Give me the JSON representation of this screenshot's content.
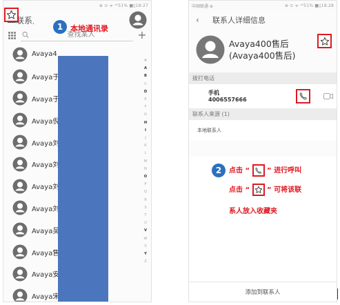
{
  "left_screen": {
    "statusbar_right": "⊕ ⊙ ᯤ ᵃˡˡ51% ■▯18:27",
    "header_title": "联系人",
    "search_placeholder": "查找某人",
    "contacts": [
      {
        "name": "Avaya4"
      },
      {
        "name": "Avaya于"
      },
      {
        "name": "Avaya于"
      },
      {
        "name": "Avaya倪"
      },
      {
        "name": "Avaya刘"
      },
      {
        "name": "Avaya刘"
      },
      {
        "name": "Avaya刘"
      },
      {
        "name": "Avaya刘"
      },
      {
        "name": "Avaya吴"
      },
      {
        "name": "Avaya售"
      },
      {
        "name": "Avaya安"
      },
      {
        "name": "Avaya宋"
      }
    ],
    "alphabet": [
      "#",
      "A",
      "B",
      "C",
      "D",
      "E",
      "F",
      "G",
      "H",
      "I",
      "J",
      "K",
      "L",
      "M",
      "N",
      "O",
      "P",
      "Q",
      "R",
      "S",
      "T",
      "U",
      "V",
      "W",
      "X",
      "Y",
      "Z"
    ],
    "alphabet_bold": [
      "A",
      "B",
      "D",
      "H",
      "I",
      "O",
      "V",
      "Y"
    ]
  },
  "right_screen": {
    "statusbar_left": "中国联通 ⊕",
    "statusbar_right": "⊕ ⊙ ᯤ ᵃˡˡ51% ■▯18:28",
    "back_icon": "‹",
    "title": "联系人详细信息",
    "contact_name_line1": "Avaya400售后",
    "contact_name_line2": "(Avaya400售后)",
    "section_dial": "拨打电话",
    "phone_label": "手机",
    "phone_number": "4006557666",
    "section_source": "联系人来源 (1)",
    "source_value": "本地联系人",
    "add_contact": "添加到联系人"
  },
  "annotations": {
    "step1_number": "1",
    "step1_text": "本地通讯录",
    "step2_number": "2",
    "step2_line1_prefix": "点击 “",
    "step2_line1_suffix": "” 进行呼叫",
    "step2_line2_prefix": "点击 “",
    "step2_line2_suffix": "” 可将该联",
    "step2_line3": "系人放入收藏夹"
  },
  "colors": {
    "annotation_red": "#e0171f",
    "step_circle_blue": "#2a70c0",
    "mask_blue": "#4b76be"
  },
  "icons": [
    "star-icon",
    "menu-icon",
    "avatar-icon",
    "dialpad-icon",
    "search-icon",
    "plus-icon",
    "phone-call-icon",
    "video-call-icon",
    "back-chevron-icon"
  ]
}
